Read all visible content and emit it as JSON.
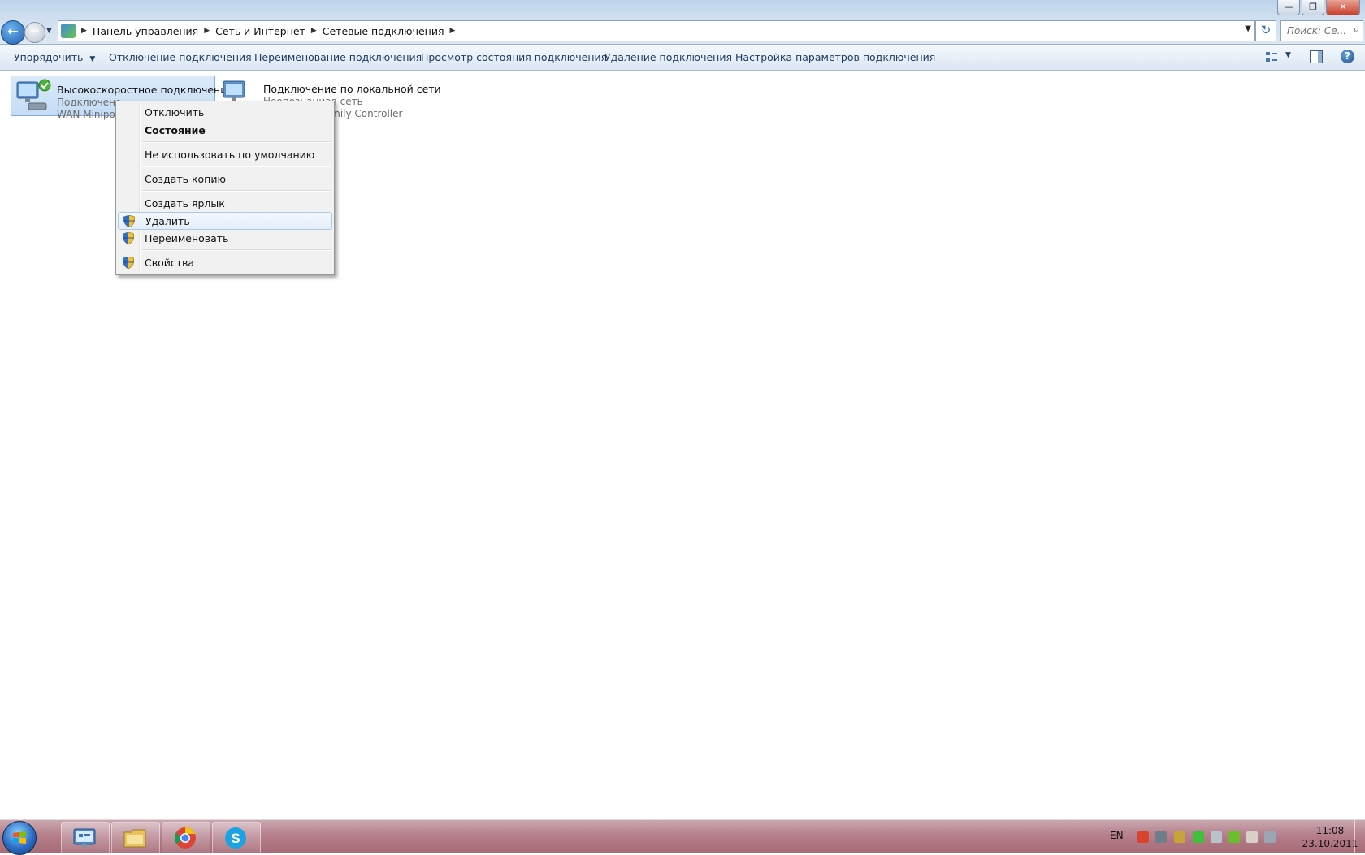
{
  "window": {
    "controls": {
      "minimize": "—",
      "maximize": "❐",
      "close": "✕"
    }
  },
  "navigation": {
    "back_glyph": "←",
    "forward_glyph": "→",
    "recent_glyph": "▼"
  },
  "breadcrumb": [
    "Панель управления",
    "Сеть и Интернет",
    "Сетевые подключения"
  ],
  "address": {
    "dropdown_glyph": "▼",
    "refresh_glyph": "↻"
  },
  "search": {
    "placeholder": "Поиск: Се...",
    "icon": "search-icon"
  },
  "toolbar": {
    "organize": "Упорядочить",
    "organize_arrow": "▼",
    "disable": "Отключение подключения",
    "rename": "Переименование подключения",
    "status": "Просмотр состояния подключения",
    "delete": "Удаление подключения",
    "settings": "Настройка параметров подключения",
    "view_arrow": "▼",
    "help": "?"
  },
  "connections": [
    {
      "name": "Высокоскоростное подключение",
      "status": "Подключено",
      "device": "WAN Minipo",
      "selected": true
    },
    {
      "name": "Подключение по локальной сети",
      "status": "Неопознанная сеть",
      "device": "Family Controller",
      "selected": false
    }
  ],
  "context_menu": {
    "items": [
      {
        "label": "Отключить",
        "bold": false,
        "shield": false
      },
      {
        "label": "Состояние",
        "bold": true,
        "shield": false
      },
      {
        "label": "Не использовать по умолчанию",
        "bold": false,
        "shield": false
      },
      {
        "label": "Создать копию",
        "bold": false,
        "shield": false
      },
      {
        "label": "Создать ярлык",
        "bold": false,
        "shield": false
      },
      {
        "label": "Удалить",
        "bold": false,
        "shield": true,
        "hover": true
      },
      {
        "label": "Переименовать",
        "bold": false,
        "shield": true
      },
      {
        "label": "Свойства",
        "bold": false,
        "shield": true
      }
    ]
  },
  "taskbar": {
    "pinned": [
      "control-panel-icon",
      "explorer-icon",
      "chrome-icon",
      "skype-icon"
    ],
    "language": "EN",
    "time": "11:08",
    "date": "23.10.2011"
  },
  "colors": {
    "selection": "#c4dcf5",
    "taskbar": "#b57f8b",
    "link": "#1e3a5f"
  }
}
